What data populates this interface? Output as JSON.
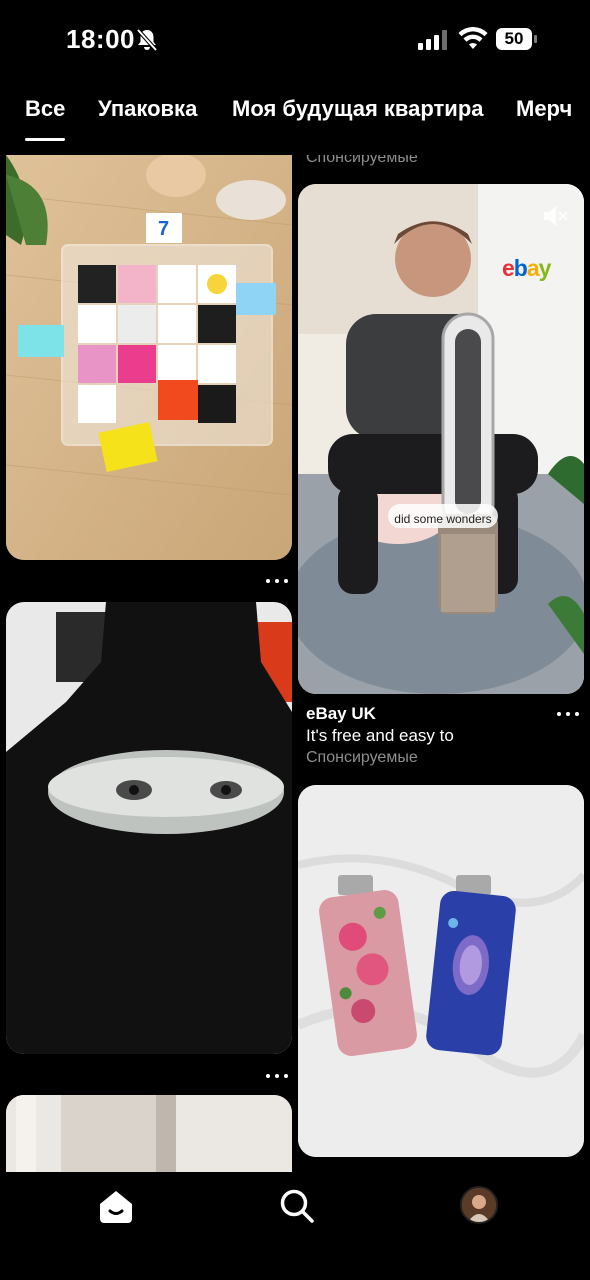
{
  "status_bar": {
    "time": "18:00",
    "battery": "50"
  },
  "tabs": [
    {
      "label": "Все",
      "active": true
    },
    {
      "label": "Упаковка",
      "active": false
    },
    {
      "label": "Моя будущая квартира",
      "active": false
    },
    {
      "label": "Мерч",
      "active": false
    }
  ],
  "feed": {
    "left": [
      {
        "image": "acrylic puzzle frame with colorful pieces"
      },
      {
        "image": "black hoodie with eyes print"
      },
      {
        "image": "hallway interior"
      }
    ],
    "right": [
      {
        "sponsored_label": "Спонсируемые"
      },
      {
        "image": "man with air purifier fan video",
        "brand_logo": "ebay",
        "caption": "did some wonders",
        "advertiser": "eBay UK",
        "description": "It's free and easy to",
        "sponsored_label": "Спонсируемые"
      },
      {
        "image": "two decorated beaded lighters on white sheet"
      }
    ]
  },
  "bottom_nav": [
    "home-icon",
    "search-icon",
    "profile-avatar"
  ]
}
